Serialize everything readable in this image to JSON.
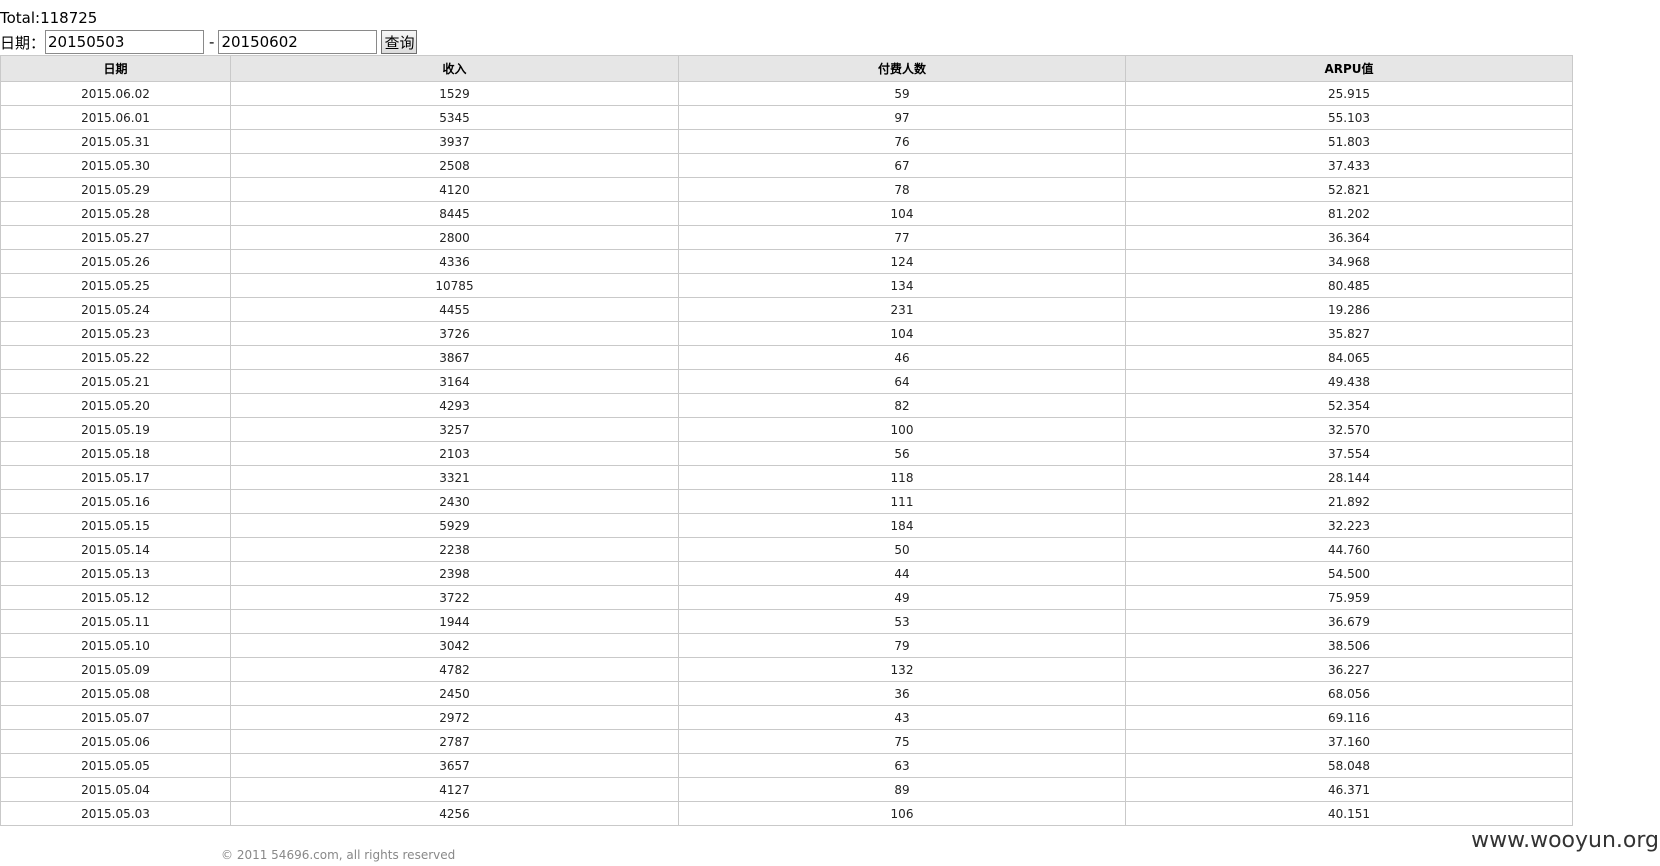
{
  "total": "Total:118725",
  "filter": {
    "label": "日期：",
    "start_date": "20150503",
    "separator": "-",
    "end_date": "20150602",
    "query_button": "查询"
  },
  "table": {
    "headers": [
      "日期",
      "收入",
      "付费人数",
      "ARPU值"
    ],
    "rows": [
      [
        "2015.06.02",
        "1529",
        "59",
        "25.915"
      ],
      [
        "2015.06.01",
        "5345",
        "97",
        "55.103"
      ],
      [
        "2015.05.31",
        "3937",
        "76",
        "51.803"
      ],
      [
        "2015.05.30",
        "2508",
        "67",
        "37.433"
      ],
      [
        "2015.05.29",
        "4120",
        "78",
        "52.821"
      ],
      [
        "2015.05.28",
        "8445",
        "104",
        "81.202"
      ],
      [
        "2015.05.27",
        "2800",
        "77",
        "36.364"
      ],
      [
        "2015.05.26",
        "4336",
        "124",
        "34.968"
      ],
      [
        "2015.05.25",
        "10785",
        "134",
        "80.485"
      ],
      [
        "2015.05.24",
        "4455",
        "231",
        "19.286"
      ],
      [
        "2015.05.23",
        "3726",
        "104",
        "35.827"
      ],
      [
        "2015.05.22",
        "3867",
        "46",
        "84.065"
      ],
      [
        "2015.05.21",
        "3164",
        "64",
        "49.438"
      ],
      [
        "2015.05.20",
        "4293",
        "82",
        "52.354"
      ],
      [
        "2015.05.19",
        "3257",
        "100",
        "32.570"
      ],
      [
        "2015.05.18",
        "2103",
        "56",
        "37.554"
      ],
      [
        "2015.05.17",
        "3321",
        "118",
        "28.144"
      ],
      [
        "2015.05.16",
        "2430",
        "111",
        "21.892"
      ],
      [
        "2015.05.15",
        "5929",
        "184",
        "32.223"
      ],
      [
        "2015.05.14",
        "2238",
        "50",
        "44.760"
      ],
      [
        "2015.05.13",
        "2398",
        "44",
        "54.500"
      ],
      [
        "2015.05.12",
        "3722",
        "49",
        "75.959"
      ],
      [
        "2015.05.11",
        "1944",
        "53",
        "36.679"
      ],
      [
        "2015.05.10",
        "3042",
        "79",
        "38.506"
      ],
      [
        "2015.05.09",
        "4782",
        "132",
        "36.227"
      ],
      [
        "2015.05.08",
        "2450",
        "36",
        "68.056"
      ],
      [
        "2015.05.07",
        "2972",
        "43",
        "69.116"
      ],
      [
        "2015.05.06",
        "2787",
        "75",
        "37.160"
      ],
      [
        "2015.05.05",
        "3657",
        "63",
        "58.048"
      ],
      [
        "2015.05.04",
        "4127",
        "89",
        "46.371"
      ],
      [
        "2015.05.03",
        "4256",
        "106",
        "40.151"
      ]
    ]
  },
  "footer": "© 2011 54696.com, all rights reserved",
  "watermark": "www.wooyun.org"
}
